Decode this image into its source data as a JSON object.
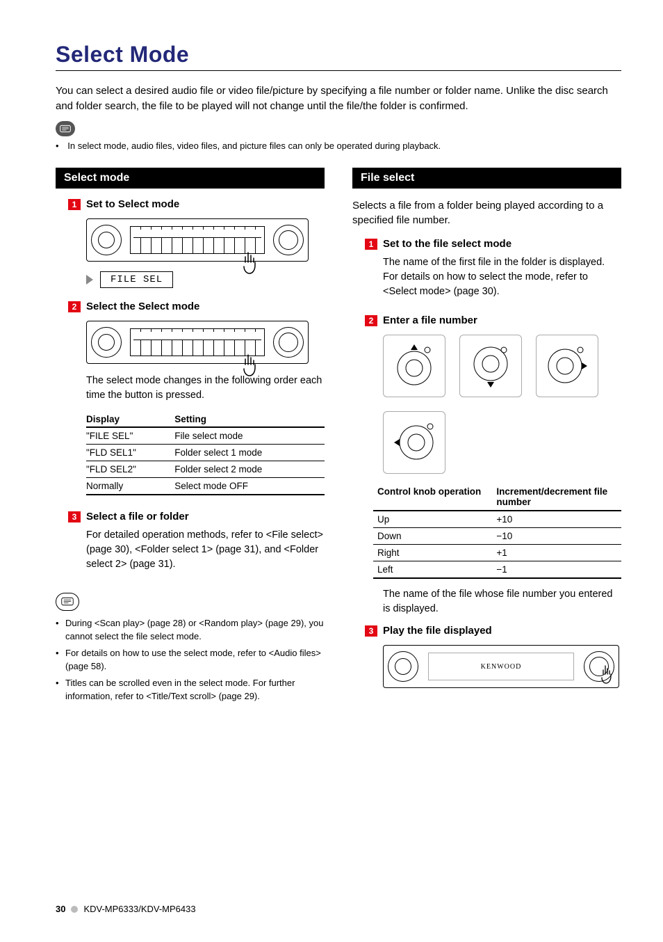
{
  "page": {
    "title": "Select Mode",
    "intro": "You can select a desired audio file or video file/picture by specifying a file number or folder name. Unlike the disc search and folder search, the file to be played will not change until the file/the folder is confirmed.",
    "top_note": "In select mode, audio files, video files, and picture files can only be operated during playback.",
    "footer_page": "30",
    "footer_model": "KDV-MP6333/KDV-MP6433"
  },
  "left": {
    "section_title": "Select mode",
    "step1": {
      "num": "1",
      "title": "Set to Select mode"
    },
    "display_label": "FILE SEL",
    "step2": {
      "num": "2",
      "title": "Select the Select mode",
      "body": "The select mode changes in the following order each time the button is pressed."
    },
    "table": {
      "headers": [
        "Display",
        "Setting"
      ],
      "rows": [
        [
          "\"FILE SEL\"",
          "File select mode"
        ],
        [
          "\"FLD SEL1\"",
          "Folder select 1 mode"
        ],
        [
          "\"FLD SEL2\"",
          "Folder select 2 mode"
        ],
        [
          "Normally",
          "Select mode OFF"
        ]
      ]
    },
    "step3": {
      "num": "3",
      "title": "Select a file or folder",
      "body": "For detailed operation methods, refer to <File select> (page 30), <Folder select 1> (page 31), and <Folder select 2> (page 31)."
    },
    "notes": [
      "During <Scan play> (page 28) or <Random play> (page 29), you cannot select the file select mode.",
      "For details on how to use the select mode, refer to <Audio files> (page 58).",
      "Titles can be scrolled even in the select mode. For further information, refer to <Title/Text scroll> (page 29)."
    ]
  },
  "right": {
    "section_title": "File select",
    "intro": "Selects a file from a folder being played according to a specified file number.",
    "step1": {
      "num": "1",
      "title": "Set to the file select mode",
      "body": "The name of the first file in the folder is displayed.\nFor details on how to select the mode, refer to <Select mode> (page 30)."
    },
    "step2": {
      "num": "2",
      "title": "Enter a file number"
    },
    "ctrl_table": {
      "headers": [
        "Control knob operation",
        "Increment/decrement file number"
      ],
      "rows": [
        [
          "Up",
          "+10"
        ],
        [
          "Down",
          "−10"
        ],
        [
          "Right",
          "+1"
        ],
        [
          "Left",
          "−1"
        ]
      ]
    },
    "step2_after": "The name of the file whose file number you entered is displayed.",
    "step3": {
      "num": "3",
      "title": "Play the file displayed"
    },
    "brand": "KENWOOD"
  }
}
